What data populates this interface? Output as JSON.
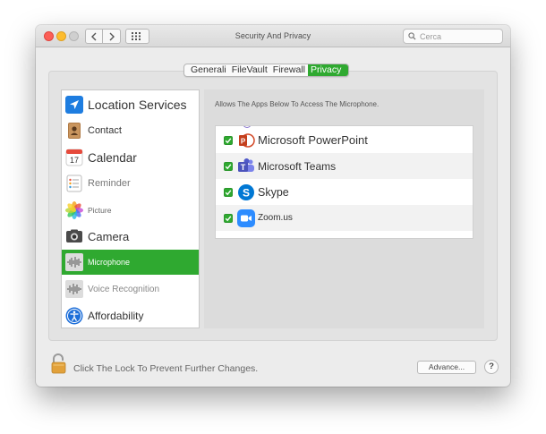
{
  "window": {
    "title": "Security And Privacy",
    "search_placeholder": "Cerca"
  },
  "tabs": [
    {
      "label": "Generali",
      "active": false
    },
    {
      "label": "FileVault",
      "active": false
    },
    {
      "label": "Firewall",
      "active": false
    },
    {
      "label": "Privacy",
      "active": true
    }
  ],
  "sidebar": {
    "items": [
      {
        "label": "Location Services",
        "icon": "location-arrow-icon",
        "selected": false
      },
      {
        "label": "Contact",
        "icon": "contacts-book-icon",
        "selected": false
      },
      {
        "label": "Calendar",
        "icon": "calendar-icon",
        "selected": false
      },
      {
        "label": "Reminder",
        "icon": "reminders-list-icon",
        "selected": false
      },
      {
        "label": "Picture",
        "icon": "photos-flower-icon",
        "selected": false
      },
      {
        "label": "Camera",
        "icon": "camera-icon",
        "selected": false
      },
      {
        "label": "Microphone",
        "icon": "microphone-waveform-icon",
        "selected": true
      },
      {
        "label": "Voice Recognition",
        "icon": "voice-waveform-icon",
        "selected": false
      },
      {
        "label": "Affordability",
        "icon": "accessibility-icon",
        "selected": false
      }
    ]
  },
  "main": {
    "description": "Allows The Apps Below To Access The Microphone.",
    "apps": [
      {
        "name": "Microsoft PowerPoint",
        "checked": true,
        "icon": "powerpoint-icon"
      },
      {
        "name": "Microsoft Teams",
        "checked": true,
        "icon": "teams-icon"
      },
      {
        "name": "Skype",
        "checked": true,
        "icon": "skype-icon"
      },
      {
        "name": "Zoom.us",
        "checked": true,
        "icon": "zoom-camera-icon"
      }
    ]
  },
  "footer": {
    "lock_text": "Click The Lock To Prevent Further Changes.",
    "advanced_label": "Advance...",
    "help_label": "?"
  },
  "colors": {
    "accent": "#2fa930",
    "window_bg": "#ececec",
    "panel_bg": "#e3e3e3"
  }
}
